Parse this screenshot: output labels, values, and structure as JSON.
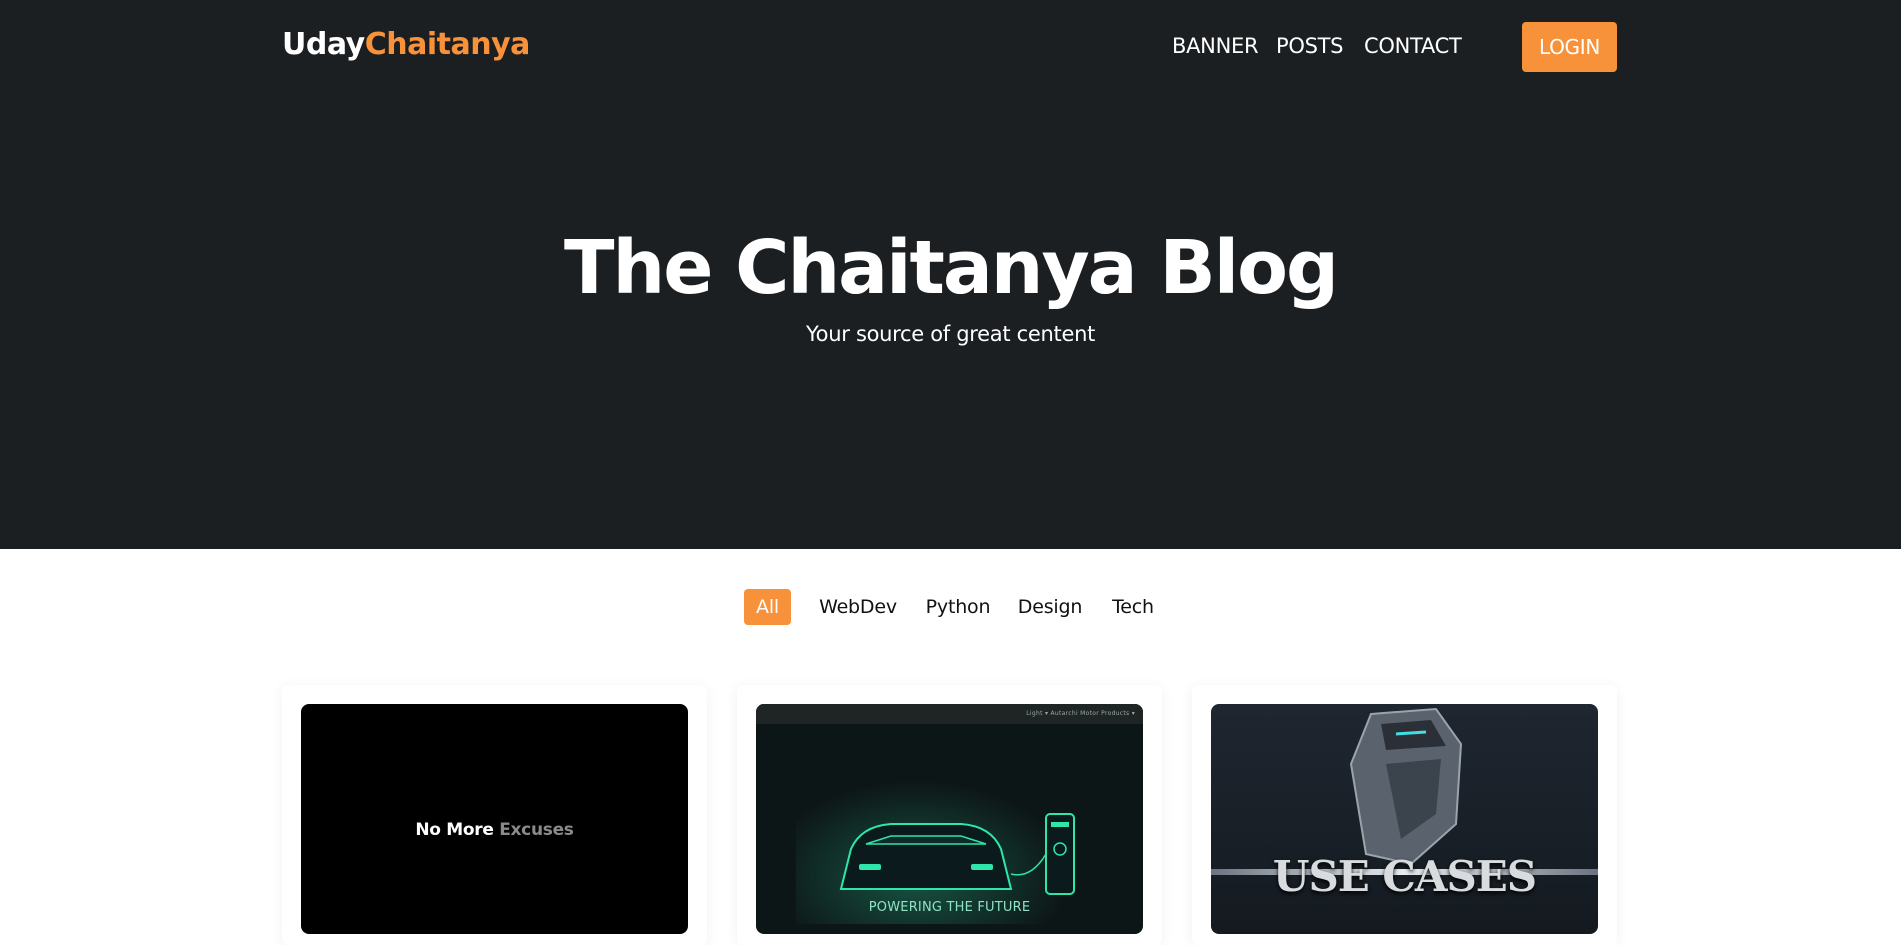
{
  "header": {
    "logo_part1": "Uday",
    "logo_part2": "Chaitanya",
    "nav": [
      "BANNER",
      "POSTS",
      "CONTACT"
    ],
    "login_label": "LOGIN"
  },
  "hero": {
    "title": "The Chaitanya Blog",
    "subtitle": "Your source of great centent"
  },
  "filters": {
    "active": "All",
    "items": [
      "WebDev",
      "Python",
      "Design",
      "Tech"
    ]
  },
  "cards": [
    {
      "image_text_main": "No More ",
      "image_text_fade": "Excuses"
    },
    {
      "image_caption": "POWERING THE FUTURE",
      "image_nav_text": "Light ▾   Autarchi Motor   Products ▾"
    },
    {
      "image_caption": "USE CASES"
    }
  ],
  "colors": {
    "header_bg": "#1c1f22",
    "accent": "#f7923a",
    "page_bg": "#ffffff"
  }
}
